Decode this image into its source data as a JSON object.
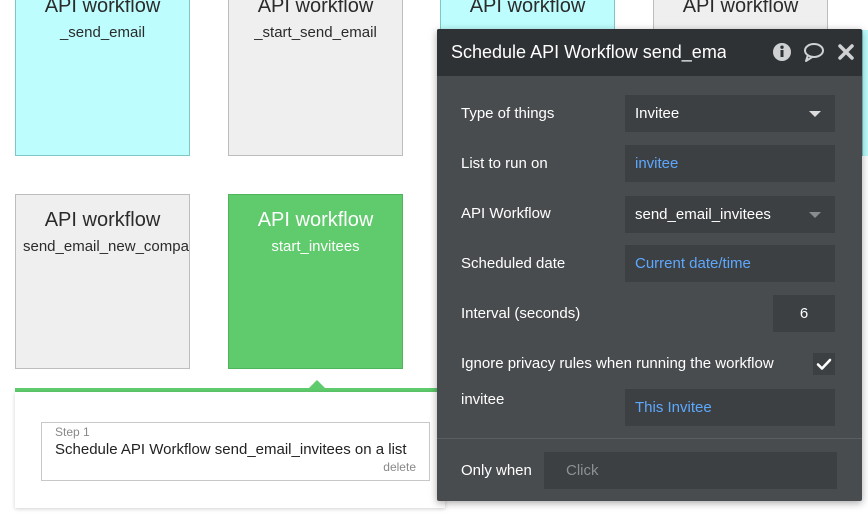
{
  "canvas": {
    "cards": [
      {
        "title": "API workflow",
        "subtitle": "_send_email"
      },
      {
        "title": "API workflow",
        "subtitle": "_start_send_email"
      },
      {
        "title": "API workflow",
        "subtitle": ""
      },
      {
        "title": "API workflow",
        "subtitle": ""
      },
      {
        "title": "API workflow",
        "subtitle": "send_email_new_compa"
      },
      {
        "title": "API workflow",
        "subtitle": "start_invitees"
      }
    ],
    "colors": {
      "cyan": "#bdfdfd",
      "gray": "#efefef",
      "green": "#5fcb6c"
    }
  },
  "step": {
    "label": "Step 1",
    "title": "Schedule API Workflow send_email_invitees on a list",
    "delete_label": "delete"
  },
  "properties": {
    "title": "Schedule API Workflow send_email_invitees",
    "icons": [
      "info-icon",
      "comment-icon",
      "close-icon"
    ],
    "type_of_things": {
      "label": "Type of things",
      "value": "Invitee"
    },
    "list_to_run_on": {
      "label": "List to run on",
      "value": "invitee"
    },
    "api_workflow": {
      "label": "API Workflow",
      "value": "send_email_invitees"
    },
    "scheduled_date": {
      "label": "Scheduled date",
      "value": "Current date/time"
    },
    "interval": {
      "label": "Interval (seconds)",
      "value": "6"
    },
    "ignore_privacy": {
      "label": "Ignore privacy rules when running the workflow",
      "checked": true
    },
    "invitee_param": {
      "label": "invitee",
      "value": "This Invitee"
    },
    "only_when": {
      "label": "Only when",
      "placeholder": "Click"
    },
    "colors": {
      "panel": "#494c4e",
      "header": "#2f3234",
      "field": "#3d4042",
      "link": "#5da8ff"
    }
  }
}
